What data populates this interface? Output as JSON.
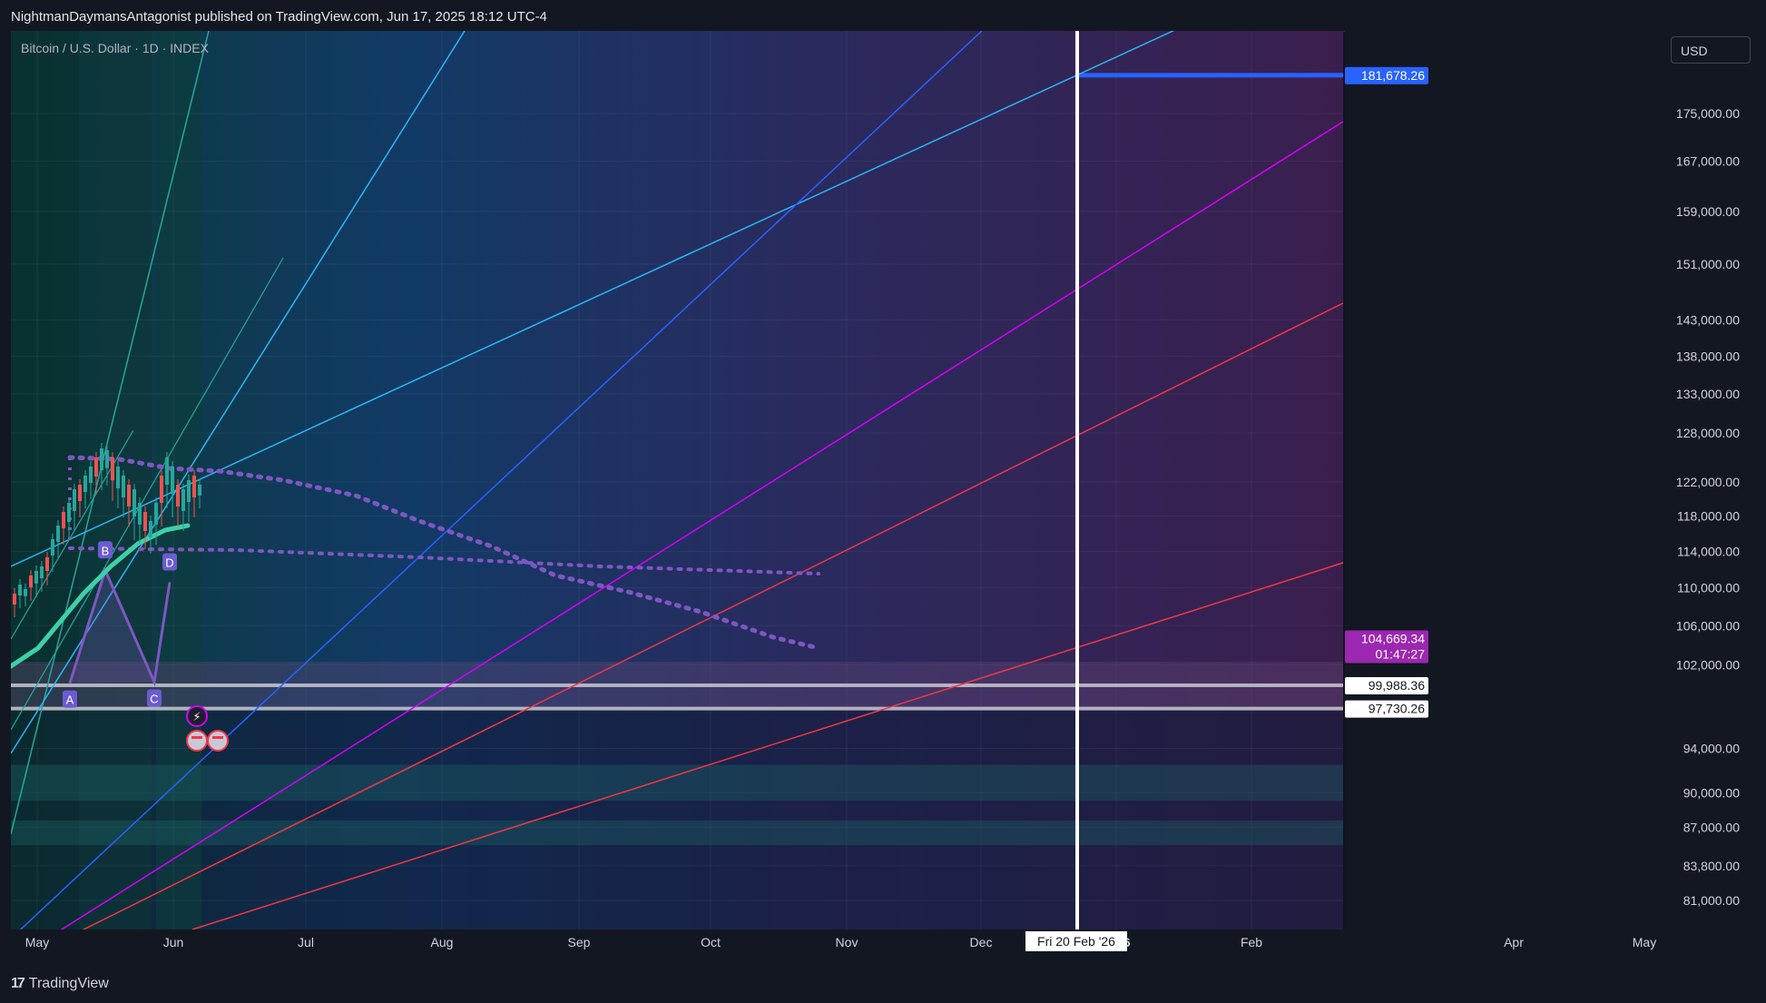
{
  "header": {
    "publish_text": "NightmanDaymansAntagonist published on TradingView.com, Jun 17, 2025 18:12 UTC-4"
  },
  "symbol_label": "Bitcoin / U.S. Dollar · 1D · INDEX",
  "currency_button": "USD",
  "footer": {
    "brand": "TradingView",
    "brand_icon": "tradingview-logo-icon"
  },
  "chart_data": {
    "type": "candlestick",
    "y_scale": "log",
    "ylim": [
      78500,
      190000
    ],
    "x_ticks": [
      "May",
      "Jun",
      "Jul",
      "Aug",
      "Sep",
      "Oct",
      "Nov",
      "Dec",
      "2026",
      "Feb",
      "Apr",
      "May"
    ],
    "y_ticks": [
      "175,000.00",
      "167,000.00",
      "159,000.00",
      "151,000.00",
      "143,000.00",
      "138,000.00",
      "133,000.00",
      "128,000.00",
      "122,000.00",
      "118,000.00",
      "114,000.00",
      "110,000.00",
      "106,000.00",
      "102,000.00",
      "94,000.00",
      "90,000.00",
      "87,000.00",
      "83,800.00",
      "81,000.00"
    ],
    "price_labels": [
      {
        "text": "181,678.26",
        "value": 181678.26,
        "color": "#2962ff"
      },
      {
        "text": "104,669.34",
        "value": 104669.34,
        "color": "#9c27b0",
        "sub": "01:47:27"
      },
      {
        "text": "99,988.36",
        "value": 99988.36,
        "color": "#ffffff"
      },
      {
        "text": "97,730.26",
        "value": 97730.26,
        "color": "#ffffff"
      }
    ],
    "crosshair_label": "Fri 20 Feb '26",
    "pattern_points": [
      {
        "label": "A",
        "value": 100200
      },
      {
        "label": "B",
        "value": 111900
      },
      {
        "label": "C",
        "value": 100300
      },
      {
        "label": "D",
        "value": 110600
      }
    ],
    "colors": {
      "teal": "#26a69a",
      "cyan": "#29b6f6",
      "blue": "#2962ff",
      "magenta": "#d500f9",
      "red": "#f23645",
      "purple": "#7e57c2"
    }
  }
}
